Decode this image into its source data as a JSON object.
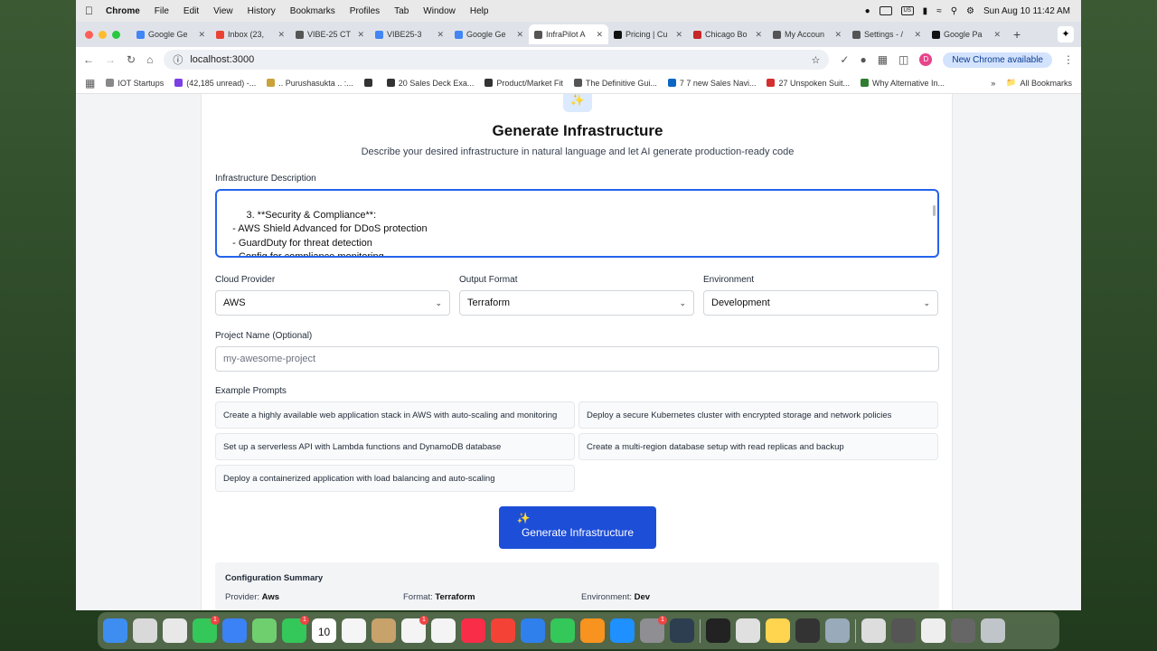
{
  "menubar": {
    "app": "Chrome",
    "items": [
      "File",
      "Edit",
      "View",
      "History",
      "Bookmarks",
      "Profiles",
      "Tab",
      "Window",
      "Help"
    ],
    "clock": "Sun Aug 10  11:42 AM",
    "indicators": [
      "US"
    ]
  },
  "tabs": [
    {
      "label": "Google Ge",
      "color": "#4285f4"
    },
    {
      "label": "Inbox (23,",
      "color": "#ea4335"
    },
    {
      "label": "VIBE-25 CT",
      "color": "#555555"
    },
    {
      "label": "VIBE25-3",
      "color": "#4285f4"
    },
    {
      "label": "Google Ge",
      "color": "#4285f4"
    },
    {
      "label": "InfraPilot A",
      "color": "#555555",
      "active": true
    },
    {
      "label": "Pricing | Cu",
      "color": "#111111"
    },
    {
      "label": "Chicago Bo",
      "color": "#c62828"
    },
    {
      "label": "My Accoun",
      "color": "#555555"
    },
    {
      "label": "Settings - /",
      "color": "#555555"
    },
    {
      "label": "Google Pa",
      "color": "#111111"
    }
  ],
  "toolbar": {
    "url": "localhost:3000",
    "new_chrome": "New Chrome available",
    "profile_initial": "D"
  },
  "bookmarks": [
    {
      "label": "IOT Startups",
      "color": "#888888"
    },
    {
      "label": "(42,185 unread) -...",
      "color": "#7b3fe4"
    },
    {
      "label": ".. Purushasukta .. :...",
      "color": "#c9a23a"
    },
    {
      "label": "",
      "color": "#333333"
    },
    {
      "label": "20 Sales Deck Exa...",
      "color": "#333333"
    },
    {
      "label": "Product/Market Fit",
      "color": "#333333"
    },
    {
      "label": "The Definitive Gui...",
      "color": "#555555"
    },
    {
      "label": "7 7 new Sales Navi...",
      "color": "#0a66c2"
    },
    {
      "label": "27 Unspoken Suit...",
      "color": "#d32f2f"
    },
    {
      "label": "Why Alternative In...",
      "color": "#2e7d32"
    }
  ],
  "bookmarks_all": "All Bookmarks",
  "page": {
    "title": "Generate Infrastructure",
    "subtitle": "Describe your desired infrastructure in natural language and let AI generate production-ready code",
    "description_label": "Infrastructure Description",
    "description_value": "3. **Security & Compliance**:\n   - AWS Shield Advanced for DDoS protection\n   - GuardDuty for threat detection\n   - Config for compliance monitoring\n   - Secrets Manager for credential management",
    "cloud_provider_label": "Cloud Provider",
    "cloud_provider_value": "AWS",
    "output_format_label": "Output Format",
    "output_format_value": "Terraform",
    "environment_label": "Environment",
    "environment_value": "Development",
    "project_name_label": "Project Name (Optional)",
    "project_name_placeholder": "my-awesome-project",
    "examples_label": "Example Prompts",
    "examples": [
      "Create a highly available web application stack in AWS with auto-scaling and monitoring",
      "Deploy a secure Kubernetes cluster with encrypted storage and network policies",
      "Set up a serverless API with Lambda functions and DynamoDB database",
      "Create a multi-region database setup with read replicas and backup",
      "Deploy a containerized application with load balancing and auto-scaling"
    ],
    "generate_button": "Generate Infrastructure",
    "summary_title": "Configuration Summary",
    "summary": {
      "provider_label": "Provider:",
      "provider_value": "Aws",
      "format_label": "Format:",
      "format_value": "Terraform",
      "environment_label": "Environment:",
      "environment_value": "Dev"
    }
  },
  "dock": [
    {
      "name": "finder",
      "color": "#3d8ef0"
    },
    {
      "name": "launchpad",
      "color": "#d9d9d9"
    },
    {
      "name": "chrome",
      "color": "#e8e8e8"
    },
    {
      "name": "messages",
      "color": "#34c759",
      "badge": "1"
    },
    {
      "name": "mail",
      "color": "#3b82f6"
    },
    {
      "name": "maps",
      "color": "#6fcf6f"
    },
    {
      "name": "facetime",
      "color": "#34c759",
      "badge": "1"
    },
    {
      "name": "calendar",
      "color": "#ffffff",
      "text": "10"
    },
    {
      "name": "photos",
      "color": "#f5f5f5"
    },
    {
      "name": "contacts",
      "color": "#c8a26b"
    },
    {
      "name": "reminders",
      "color": "#f4f4f4",
      "badge": "1"
    },
    {
      "name": "freeform",
      "color": "#f4f4f4"
    },
    {
      "name": "music",
      "color": "#fa2d48"
    },
    {
      "name": "news",
      "color": "#f44336"
    },
    {
      "name": "keynote",
      "color": "#2f80ed"
    },
    {
      "name": "numbers",
      "color": "#34c759"
    },
    {
      "name": "pages",
      "color": "#f7931e"
    },
    {
      "name": "app-store",
      "color": "#1e90ff"
    },
    {
      "name": "system-settings",
      "color": "#8e8e93",
      "badge": "1"
    },
    {
      "name": "quicktime",
      "color": "#2c3e50"
    },
    {
      "name": "terminal",
      "color": "#222222"
    },
    {
      "name": "colorsync",
      "color": "#e0e0e0"
    },
    {
      "name": "notes",
      "color": "#ffd54f"
    },
    {
      "name": "cursor",
      "color": "#333333"
    },
    {
      "name": "preview",
      "color": "#9ab"
    },
    {
      "name": "document",
      "color": "#ddd"
    },
    {
      "name": "document-2",
      "color": "#555"
    },
    {
      "name": "document-3",
      "color": "#eee"
    },
    {
      "name": "document-4",
      "color": "#666"
    },
    {
      "name": "trash",
      "color": "#bfc5c9"
    }
  ]
}
